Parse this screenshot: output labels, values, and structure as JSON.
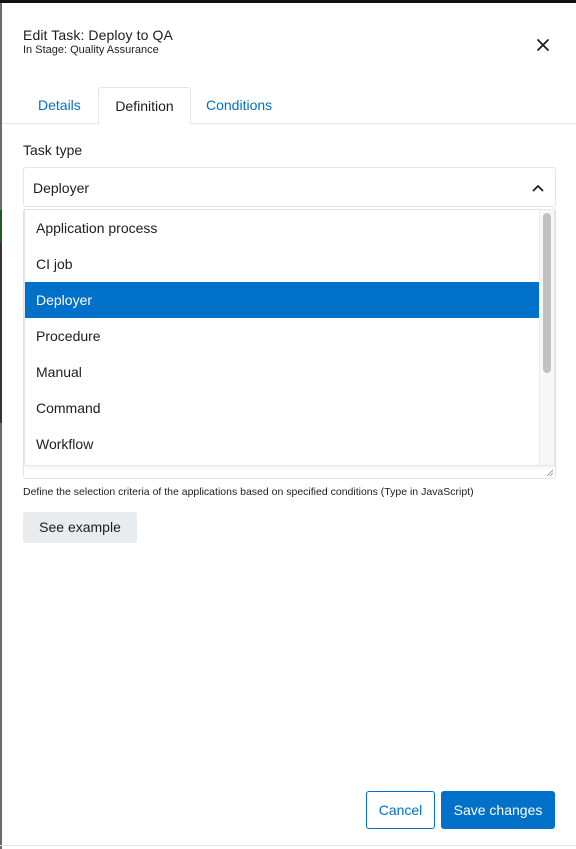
{
  "modal": {
    "title": "Edit Task: Deploy to QA",
    "subtitle": "In Stage: Quality Assurance",
    "close_icon": "close-icon"
  },
  "tabs": [
    {
      "label": "Details",
      "active": false
    },
    {
      "label": "Definition",
      "active": true
    },
    {
      "label": "Conditions",
      "active": false
    }
  ],
  "task_type": {
    "label": "Task type",
    "value": "Deployer",
    "chevron_icon": "chevron-up-icon",
    "options": [
      {
        "label": "Application process",
        "selected": false
      },
      {
        "label": "CI job",
        "selected": false
      },
      {
        "label": "Deployer",
        "selected": true
      },
      {
        "label": "Procedure",
        "selected": false
      },
      {
        "label": "Manual",
        "selected": false
      },
      {
        "label": "Command",
        "selected": false
      },
      {
        "label": "Workflow",
        "selected": false
      }
    ]
  },
  "selection_criteria": {
    "help_text": "Define the selection criteria of the applications based on specified conditions (Type in JavaScript)",
    "see_example_label": "See example"
  },
  "footer": {
    "cancel_label": "Cancel",
    "save_label": "Save changes"
  },
  "colors": {
    "accent": "#0070c9",
    "selected_option_bg": "#0070c9",
    "secondary_button_bg": "#e8ecef",
    "border": "#e3e6e8"
  }
}
